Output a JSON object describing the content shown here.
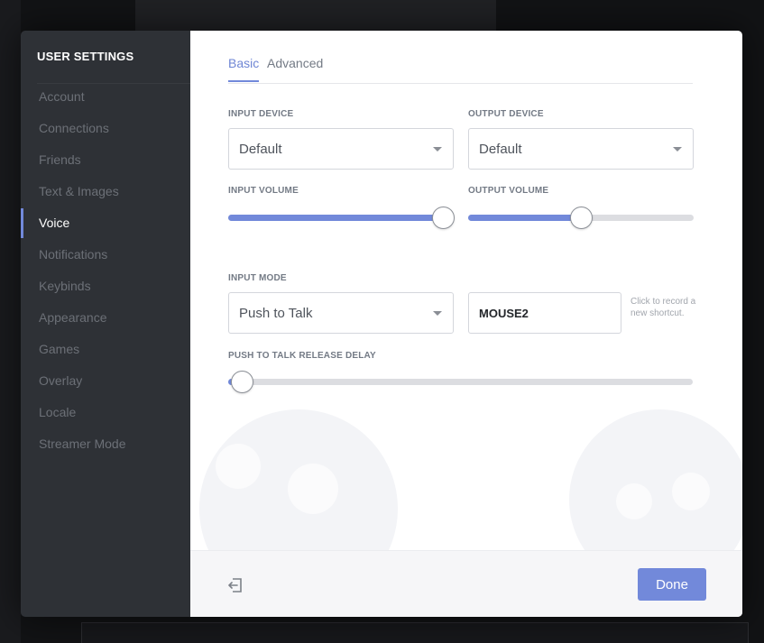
{
  "sidebar": {
    "title": "USER SETTINGS",
    "items": [
      {
        "label": "Account"
      },
      {
        "label": "Connections"
      },
      {
        "label": "Friends"
      },
      {
        "label": "Text & Images"
      },
      {
        "label": "Voice"
      },
      {
        "label": "Notifications"
      },
      {
        "label": "Keybinds"
      },
      {
        "label": "Appearance"
      },
      {
        "label": "Games"
      },
      {
        "label": "Overlay"
      },
      {
        "label": "Locale"
      },
      {
        "label": "Streamer Mode"
      }
    ],
    "active": "Voice"
  },
  "tabs": [
    {
      "label": "Basic",
      "active": true
    },
    {
      "label": "Advanced",
      "active": false
    }
  ],
  "input_device": {
    "label": "INPUT DEVICE",
    "value": "Default"
  },
  "output_device": {
    "label": "OUTPUT DEVICE",
    "value": "Default"
  },
  "input_volume": {
    "label": "INPUT VOLUME",
    "level": 0.95
  },
  "output_volume": {
    "label": "OUTPUT VOLUME",
    "level": 0.5
  },
  "input_mode": {
    "label": "INPUT MODE",
    "value": "Push to Talk"
  },
  "shortcut": {
    "value": "MOUSE2",
    "hint": "Click to record a new shortcut."
  },
  "ptt_release_delay": {
    "label": "PUSH TO TALK RELEASE DELAY",
    "level": 0.03
  },
  "footer": {
    "done_label": "Done",
    "exit_icon": "exit-icon"
  },
  "colors": {
    "accent": "#7289da",
    "sidebar_bg": "#2e3136",
    "active_text": "#ffffff",
    "muted_text": "#6c7077"
  }
}
